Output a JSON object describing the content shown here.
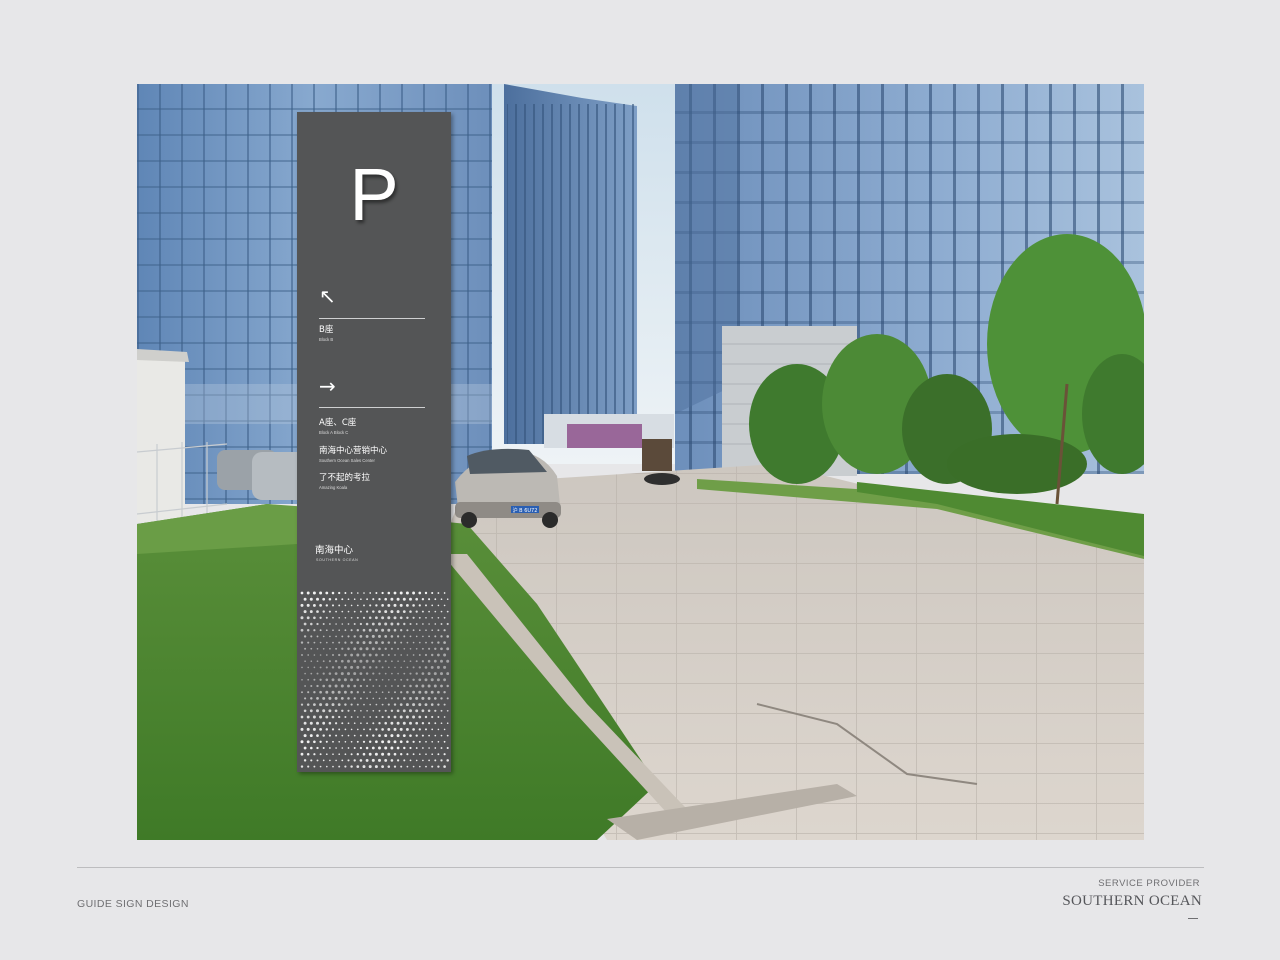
{
  "sign": {
    "parking_letter": "P",
    "arrow_up_left": "↖",
    "arrow_right": "→",
    "destinations": [
      {
        "zh": "B座",
        "en": "Block B"
      },
      {
        "zh": "A座、C座",
        "en": "Block A  Block C"
      },
      {
        "zh": "南海中心营销中心",
        "en": "Southern Ocean Sales Center"
      },
      {
        "zh": "了不起的考拉",
        "en": "Amazing Koala"
      }
    ],
    "logo_zh": "南海中心",
    "logo_en": "SOUTHERN OCEAN"
  },
  "car": {
    "plate": "沪 B 6U72"
  },
  "footer": {
    "left_label": "GUIDE SIGN DESIGN",
    "right_small": "SERVICE PROVIDER",
    "right_large": "SOUTHERN OCEAN"
  }
}
